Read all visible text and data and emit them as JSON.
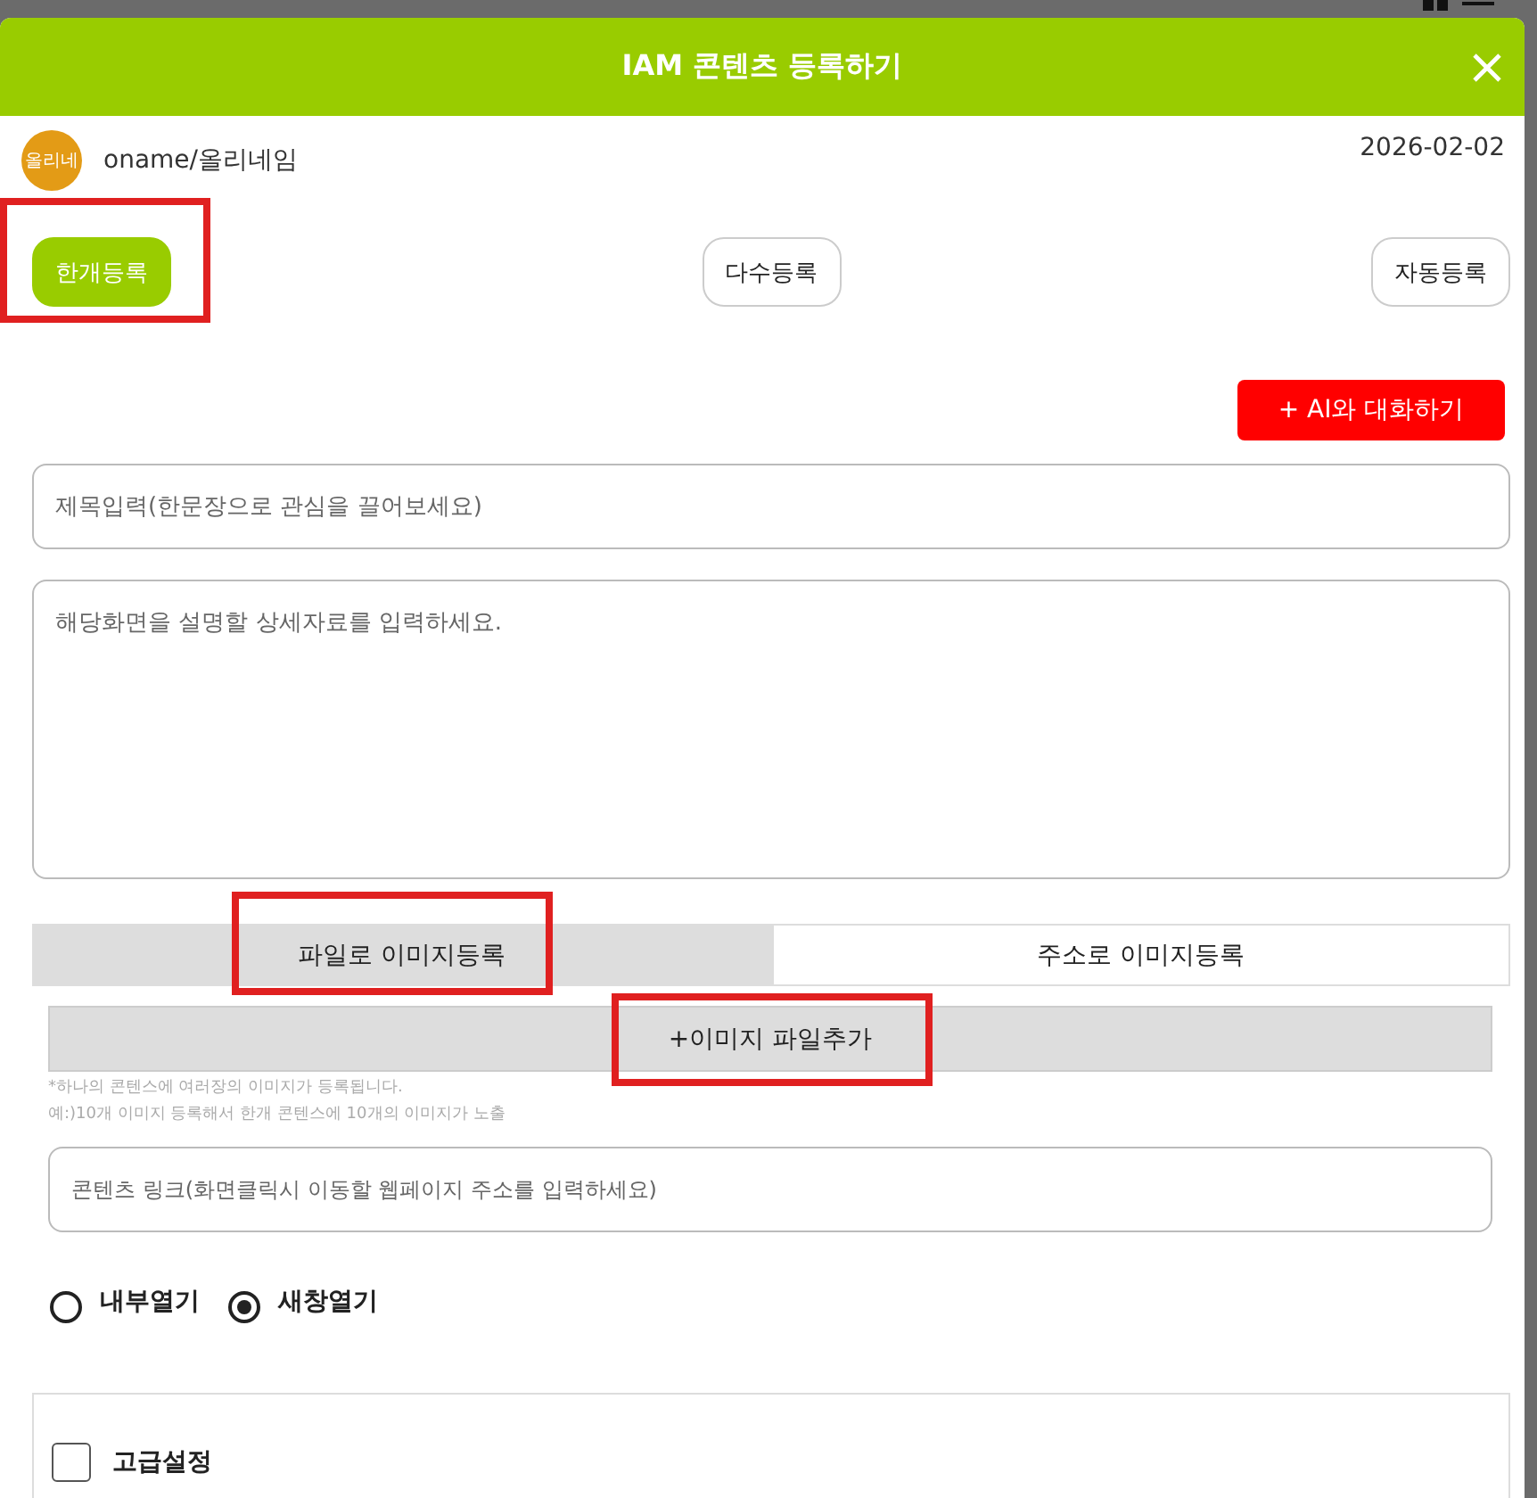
{
  "dialog": {
    "title": "IAM 콘텐츠 등록하기"
  },
  "author": {
    "avatar_text": "올리네",
    "name": "oname/올리네임",
    "date": "2026-02-02"
  },
  "modes": [
    {
      "label": "한개등록",
      "selected": true,
      "highlighted": true
    },
    {
      "label": "다수등록",
      "selected": false,
      "highlighted": false
    },
    {
      "label": "자동등록",
      "selected": false,
      "highlighted": false
    }
  ],
  "ai_button": "+ AI와 대화하기",
  "title_field": {
    "placeholder": "제목입력(한문장으로 관심을 끌어보세요)"
  },
  "detail_field": {
    "placeholder": "해당화면을 설명할 상세자료를 입력하세요."
  },
  "image_tabs": [
    {
      "label": "파일로 이미지등록",
      "selected": true,
      "highlighted": true
    },
    {
      "label": "주소로 이미지등록",
      "selected": false,
      "highlighted": false
    }
  ],
  "add_file_button": {
    "label": "+이미지 파일추가",
    "highlighted": true
  },
  "notes": [
    "*하나의 콘텐스에 여러장의 이미지가 등록됩니다.",
    "예:)10개 이미지 등록해서 한개 콘텐스에 10개의 이미지가 노출"
  ],
  "link_field": {
    "placeholder": "콘텐츠 링크(화면클릭시 이동할 웹페이지 주소를 입력하세요)"
  },
  "open_options": [
    {
      "label": "내부열기",
      "selected": false
    },
    {
      "label": "새창열기",
      "selected": true
    }
  ],
  "advanced": {
    "label": "고급설정",
    "checked": false
  }
}
